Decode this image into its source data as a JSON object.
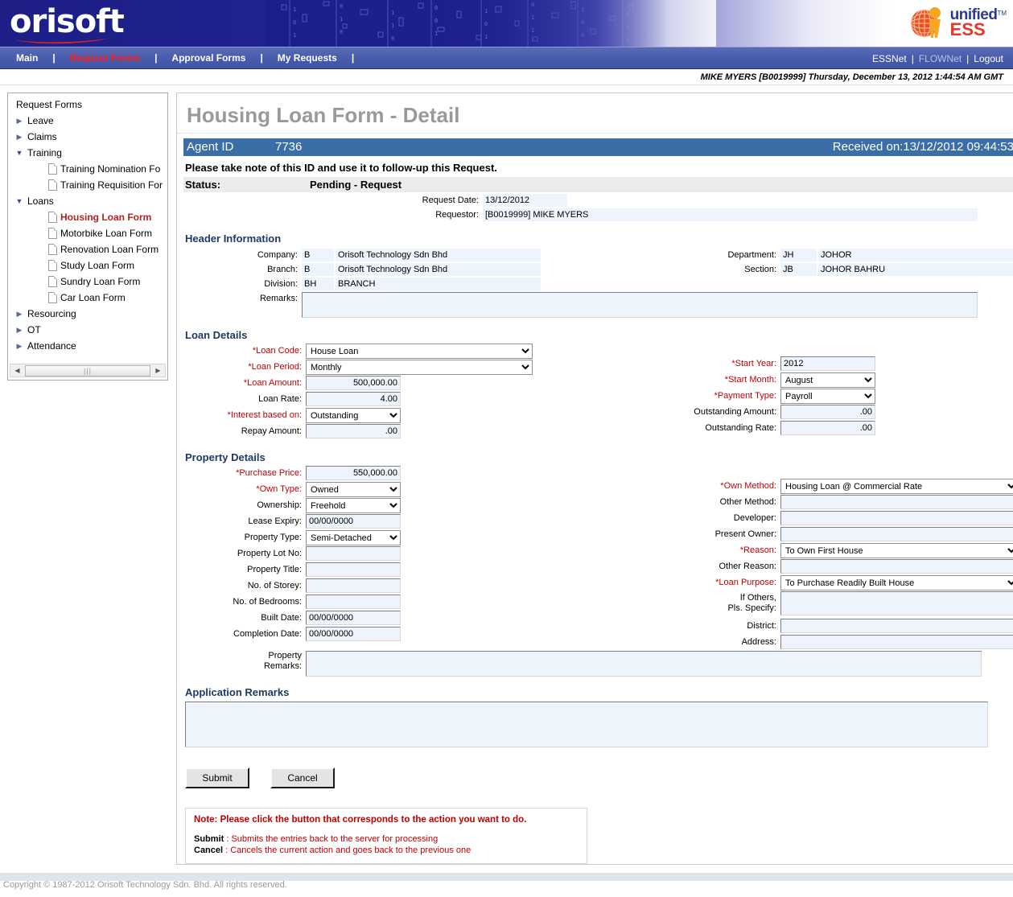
{
  "brand": {
    "logo_text": "orisoft",
    "ess_unified": "unified",
    "ess_tm": "TM",
    "ess_ess": "ESS",
    "accent_blue": "#3a6ea5",
    "nav_active_red": "#ff1b1b",
    "required_red": "#c00000",
    "section_navy": "#1f3864"
  },
  "nav": {
    "items": [
      {
        "label": "Main",
        "active": false
      },
      {
        "label": "Request Forms",
        "active": true
      },
      {
        "label": "Approval Forms",
        "active": false
      },
      {
        "label": "My Requests",
        "active": false
      }
    ],
    "separator": "|",
    "right": {
      "essnet": "ESSNet",
      "flownet": "FLOWNet",
      "logout": "Logout"
    }
  },
  "userbar": {
    "text": "MIKE MYERS [B0019999] Thursday, December 13, 2012 1:44:54 AM GMT"
  },
  "sidebar": {
    "title": "Request Forms",
    "nodes": [
      {
        "type": "node",
        "label": "Leave",
        "state": "closed"
      },
      {
        "type": "node",
        "label": "Claims",
        "state": "closed"
      },
      {
        "type": "node",
        "label": "Training",
        "state": "open"
      },
      {
        "type": "leaf",
        "label": "Training Nomination Fo",
        "selected": false
      },
      {
        "type": "leaf",
        "label": "Training Requisition For",
        "selected": false
      },
      {
        "type": "node",
        "label": "Loans",
        "state": "open"
      },
      {
        "type": "leaf",
        "label": "Housing Loan Form",
        "selected": true
      },
      {
        "type": "leaf",
        "label": "Motorbike Loan Form",
        "selected": false
      },
      {
        "type": "leaf",
        "label": "Renovation Loan Form",
        "selected": false
      },
      {
        "type": "leaf",
        "label": "Study Loan Form",
        "selected": false
      },
      {
        "type": "leaf",
        "label": "Sundry Loan Form",
        "selected": false
      },
      {
        "type": "leaf",
        "label": "Car Loan Form",
        "selected": false
      },
      {
        "type": "node",
        "label": "Resourcing",
        "state": "closed"
      },
      {
        "type": "node",
        "label": "OT",
        "state": "closed"
      },
      {
        "type": "node",
        "label": "Attendance",
        "state": "closed"
      }
    ]
  },
  "form": {
    "title": "Housing Loan Form - Detail",
    "agent_id_label": "Agent ID",
    "agent_id_value": "7736",
    "received_label": "Received on:",
    "received_value": "13/12/2012 09:44:53",
    "notice": "Please take note of this ID and use it to follow-up this Request.",
    "status_label": "Status:",
    "status_value": "Pending - Request",
    "request_date_label": "Request Date:",
    "request_date_value": "13/12/2012",
    "requestor_label": "Requestor:",
    "requestor_value": "[B0019999] MIKE MYERS"
  },
  "header_info": {
    "title": "Header Information",
    "company_label": "Company:",
    "company_code": "B",
    "company_name": "Orisoft Technology Sdn Bhd",
    "branch_label": "Branch:",
    "branch_code": "B",
    "branch_name": "Orisoft Technology Sdn Bhd",
    "division_label": "Division:",
    "division_code": "BH",
    "division_name": "BRANCH",
    "remarks_label": "Remarks:",
    "remarks_value": "",
    "department_label": "Department:",
    "department_code": "JH",
    "department_name": "JOHOR",
    "section_label": "Section:",
    "section_code": "JB",
    "section_name": "JOHOR BAHRU"
  },
  "loan_details": {
    "title": "Loan Details",
    "loan_code_label": "*Loan Code:",
    "loan_code_value": "House Loan",
    "loan_period_label": "*Loan Period:",
    "loan_period_value": "Monthly",
    "loan_amount_label": "*Loan Amount:",
    "loan_amount_value": "500,000.00",
    "loan_rate_label": "Loan Rate:",
    "loan_rate_value": "4.00",
    "interest_based_label": "*Interest based on:",
    "interest_based_value": "Outstanding",
    "repay_amount_label": "Repay Amount:",
    "repay_amount_value": ".00",
    "start_year_label": "*Start Year:",
    "start_year_value": "2012",
    "start_month_label": "*Start Month:",
    "start_month_value": "August",
    "payment_type_label": "*Payment Type:",
    "payment_type_value": "Payroll",
    "outstanding_amount_label": "Outstanding Amount:",
    "outstanding_amount_value": ".00",
    "outstanding_rate_label": "Outstanding Rate:",
    "outstanding_rate_value": ".00"
  },
  "property_details": {
    "title": "Property Details",
    "purchase_price_label": "*Purchase Price:",
    "purchase_price_value": "550,000.00",
    "own_type_label": "*Own Type:",
    "own_type_value": "Owned",
    "ownership_label": "Ownership:",
    "ownership_value": "Freehold",
    "lease_expiry_label": "Lease Expiry:",
    "lease_expiry_value": "00/00/0000",
    "property_type_label": "Property Type:",
    "property_type_value": "Semi-Detached",
    "property_lot_label": "Property Lot No:",
    "property_lot_value": "",
    "property_title_label": "Property Title:",
    "property_title_value": "",
    "no_storey_label": "No. of Storey:",
    "no_storey_value": "",
    "no_bedrooms_label": "No. of Bedrooms:",
    "no_bedrooms_value": "",
    "built_date_label": "Built Date:",
    "built_date_value": "00/00/0000",
    "completion_date_label": "Completion Date:",
    "completion_date_value": "00/00/0000",
    "property_remarks_label_1": "Property",
    "property_remarks_label_2": "Remarks:",
    "property_remarks_value": "",
    "own_method_label": "*Own Method:",
    "own_method_value": "Housing Loan @ Commercial Rate",
    "other_method_label": "Other Method:",
    "other_method_value": "",
    "developer_label": "Developer:",
    "developer_value": "",
    "present_owner_label": "Present Owner:",
    "present_owner_value": "",
    "reason_label": "*Reason:",
    "reason_value": "To Own First House",
    "other_reason_label": "Other Reason:",
    "other_reason_value": "",
    "loan_purpose_label": "*Loan Purpose:",
    "loan_purpose_value": "To Purchase Readily Built House",
    "if_others_label_1": "If Others,",
    "if_others_label_2": "Pls. Specify:",
    "if_others_value": "",
    "district_label": "District:",
    "district_value": "",
    "address_label": "Address:",
    "address_value": ""
  },
  "application_remarks": {
    "title": "Application Remarks",
    "value": ""
  },
  "buttons": {
    "submit": "Submit",
    "cancel": "Cancel"
  },
  "note": {
    "heading": "Note: Please click the button that corresponds to the action you want to do.",
    "submit_key": "Submit",
    "submit_sep": " : ",
    "submit_desc": "Submits the entries back to the server for processing",
    "cancel_key": "Cancel",
    "cancel_sep": " : ",
    "cancel_desc": "Cancels the current action and goes back to the previous one"
  },
  "footer": {
    "copyright": "Copyright © 1987-2012 Orisoft Technology Sdn. Bhd. All rights reserved."
  }
}
